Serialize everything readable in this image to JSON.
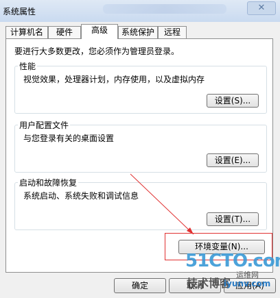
{
  "window": {
    "title": "系统属性",
    "close_glyph": "✕"
  },
  "tabs": [
    {
      "label": "计算机名"
    },
    {
      "label": "硬件"
    },
    {
      "label": "高级"
    },
    {
      "label": "系统保护"
    },
    {
      "label": "远程"
    }
  ],
  "intro": "要进行大多数更改，您必须作为管理员登录。",
  "performance": {
    "title": "性能",
    "desc": "视觉效果，处理器计划，内存使用，以及虚拟内存",
    "button": "设置(S)..."
  },
  "profiles": {
    "title": "用户配置文件",
    "desc": "与您登录有关的桌面设置",
    "button": "设置(E)..."
  },
  "startup": {
    "title": "启动和故障恢复",
    "desc": "系统启动、系统失败和调试信息",
    "button": "设置(T)..."
  },
  "env_button": "环境变量(N)...",
  "footer": {
    "ok": "确定",
    "cancel": "取消",
    "apply": "应用(A)"
  },
  "watermark": {
    "brand": "51CTO.com",
    "sub": "技术博客",
    "tag": "运维网",
    "site": "iyunv.com"
  },
  "colors": {
    "annotation": "#e03030",
    "watermark": "#3a9ad6"
  }
}
